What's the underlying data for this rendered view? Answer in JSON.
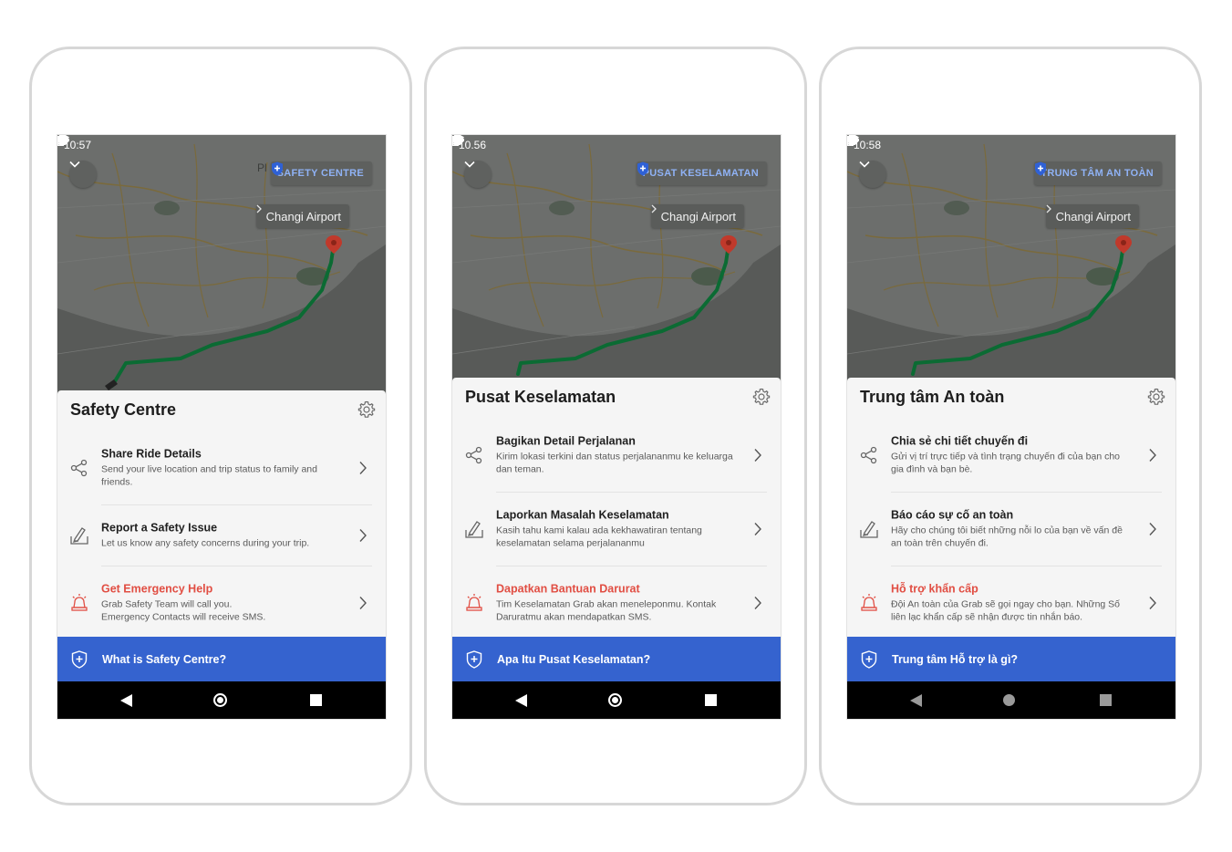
{
  "screens": [
    {
      "time": "10:57",
      "map_partial_label": "Pl",
      "safety_chip": "SAFETY CENTRE",
      "destination": "Changi Airport",
      "title": "Safety Centre",
      "items": [
        {
          "title": "Share Ride Details",
          "desc": "Send your live location and trip status to family and friends."
        },
        {
          "title": "Report a Safety Issue",
          "desc": "Let us know any safety concerns during your trip."
        },
        {
          "title": "Get Emergency Help",
          "desc": "Grab Safety Team will call you.\nEmergency Contacts will receive SMS."
        }
      ],
      "info": "What is Safety Centre?"
    },
    {
      "time": "10.56",
      "map_partial_label": "",
      "safety_chip": "PUSAT KESELAMATAN",
      "destination": "Changi Airport",
      "title": "Pusat Keselamatan",
      "items": [
        {
          "title": "Bagikan Detail Perjalanan",
          "desc": "Kirim lokasi terkini dan status perjalananmu ke keluarga dan teman."
        },
        {
          "title": "Laporkan Masalah Keselamatan",
          "desc": "Kasih tahu kami kalau ada kekhawatiran tentang keselamatan selama perjalananmu"
        },
        {
          "title": "Dapatkan Bantuan Darurat",
          "desc": "Tim Keselamatan Grab akan meneleponmu. Kontak Daruratmu akan mendapatkan SMS."
        }
      ],
      "info": "Apa Itu Pusat Keselamatan?"
    },
    {
      "time": "10:58",
      "map_partial_label": "",
      "safety_chip": "TRUNG TÂM AN TOÀN",
      "destination": "Changi Airport",
      "title": "Trung tâm An toàn",
      "items": [
        {
          "title": "Chia sẻ chi tiết chuyến đi",
          "desc": "Gửi vị trí trực tiếp và tình trạng chuyến đi của bạn cho gia đình và bạn bè."
        },
        {
          "title": "Báo cáo sự cố an toàn",
          "desc": "Hãy cho chúng tôi biết những nỗi lo của bạn về vấn đề an toàn trên chuyến đi."
        },
        {
          "title": "Hỗ trợ khẩn cấp",
          "desc": "Đội An toàn của Grab sẽ gọi ngay cho bạn. Những Số liên lạc khẩn cấp sẽ nhận được tin nhắn báo."
        }
      ],
      "info": "Trung tâm Hỗ trợ là gì?"
    }
  ],
  "icons": {
    "status_left": "car-icon",
    "status_right": [
      "location-icon",
      "vibrate-icon",
      "wifi-icon",
      "signal-icon",
      "battery-icon"
    ],
    "item_icons": [
      "share-icon",
      "report-icon",
      "emergency-siren-icon"
    ],
    "info_icon": "shield-plus-icon",
    "nav": [
      "back-icon",
      "home-icon",
      "recents-icon"
    ]
  },
  "colors": {
    "brand_blue": "#3563cf",
    "danger_red": "#e14e43",
    "route_green": "#0b6b33",
    "map_base": "#6c6e6c",
    "pin_red": "#c0392b"
  }
}
